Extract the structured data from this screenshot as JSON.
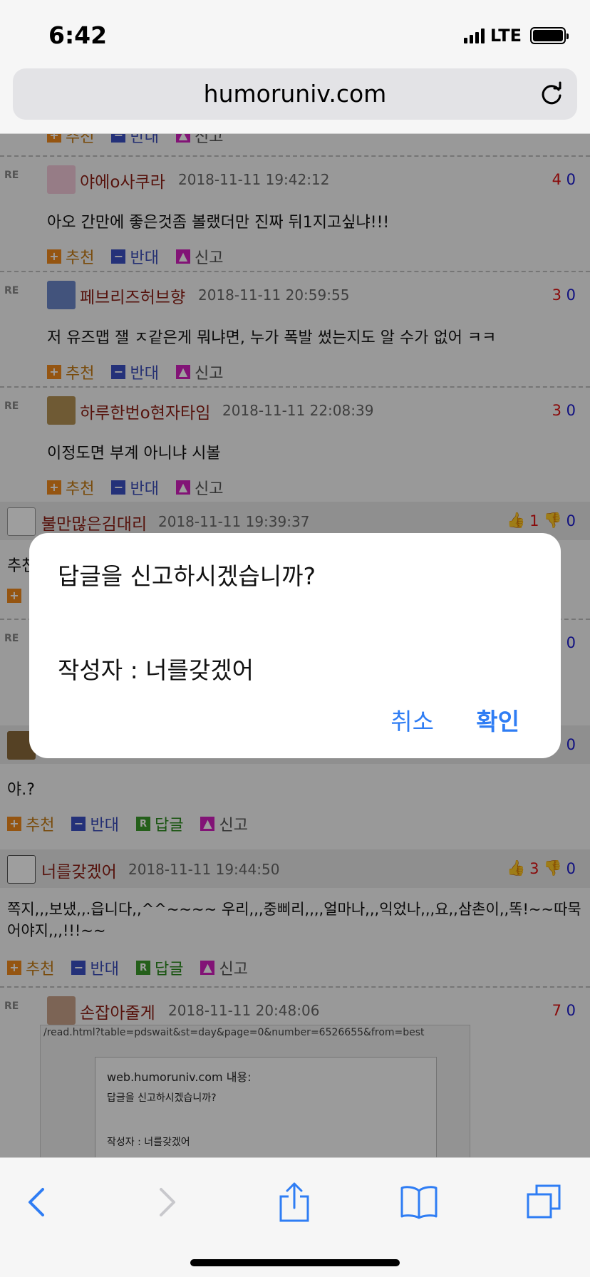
{
  "status_bar": {
    "time": "6:42",
    "network": "LTE"
  },
  "browser": {
    "url": "humoruniv.com"
  },
  "actions": {
    "recommend": "추천",
    "oppose": "반대",
    "reply": "답글",
    "report": "신고"
  },
  "re_label": "RE",
  "replies_top": [
    {
      "nick": "야에o사쿠라",
      "date": "2018-11-11 19:42:12",
      "up": "4",
      "down": "0",
      "text": "아오 간만에 좋은것좀 볼랬더만 진짜 뒤1지고싶냐!!!"
    },
    {
      "nick": "페브리즈허브향",
      "date": "2018-11-11 20:59:55",
      "up": "3",
      "down": "0",
      "text": "저 유즈맵 잴 ㅈ같은게 뭐냐면, 누가 폭발 썼는지도 알 수가 없어 ㅋㅋ"
    },
    {
      "nick": "하루한번o현자타임",
      "date": "2018-11-11 22:08:39",
      "up": "3",
      "down": "0",
      "text": "이정도면 부계 아니냐 시볼"
    }
  ],
  "comment1": {
    "nick": "불만많은김대리",
    "date": "2018-11-11 19:39:37",
    "up": "1",
    "down": "0",
    "text_partial": "추천"
  },
  "partial_reply": {
    "down": "0"
  },
  "comment2": {
    "down": "0",
    "text": "야.?"
  },
  "comment3": {
    "nick": "너를갖겠어",
    "date": "2018-11-11 19:44:50",
    "up": "3",
    "down": "0",
    "text_line1": "쪽지,,,보냈,,.읍니다,,^^~~~~ 우리,,,중삐리,,,,얼마나,,,익었나,,,요,,삼촌이,,똑!~~따묵",
    "text_line2": "어야지,,,!!!~~"
  },
  "reply_last": {
    "nick": "손잡아줄게",
    "date": "2018-11-11 20:48:06",
    "up": "7",
    "down": "0"
  },
  "embedded": {
    "url": "/read.html?table=pdswait&st=day&page=0&number=6526655&from=best",
    "title": "web.humoruniv.com 내용:",
    "line1": "답글을 신고하시겠습니까?",
    "line2": "작성자 : 너를갖겠어"
  },
  "alert": {
    "title": "답글을 신고하시겠습니까?",
    "message": "작성자 : 너를갖겠어",
    "cancel": "취소",
    "confirm": "확인"
  },
  "colors": {
    "accent": "#2f7df4",
    "nick": "#8b1e14",
    "up": "#dd1111",
    "down": "#1a1acf"
  }
}
